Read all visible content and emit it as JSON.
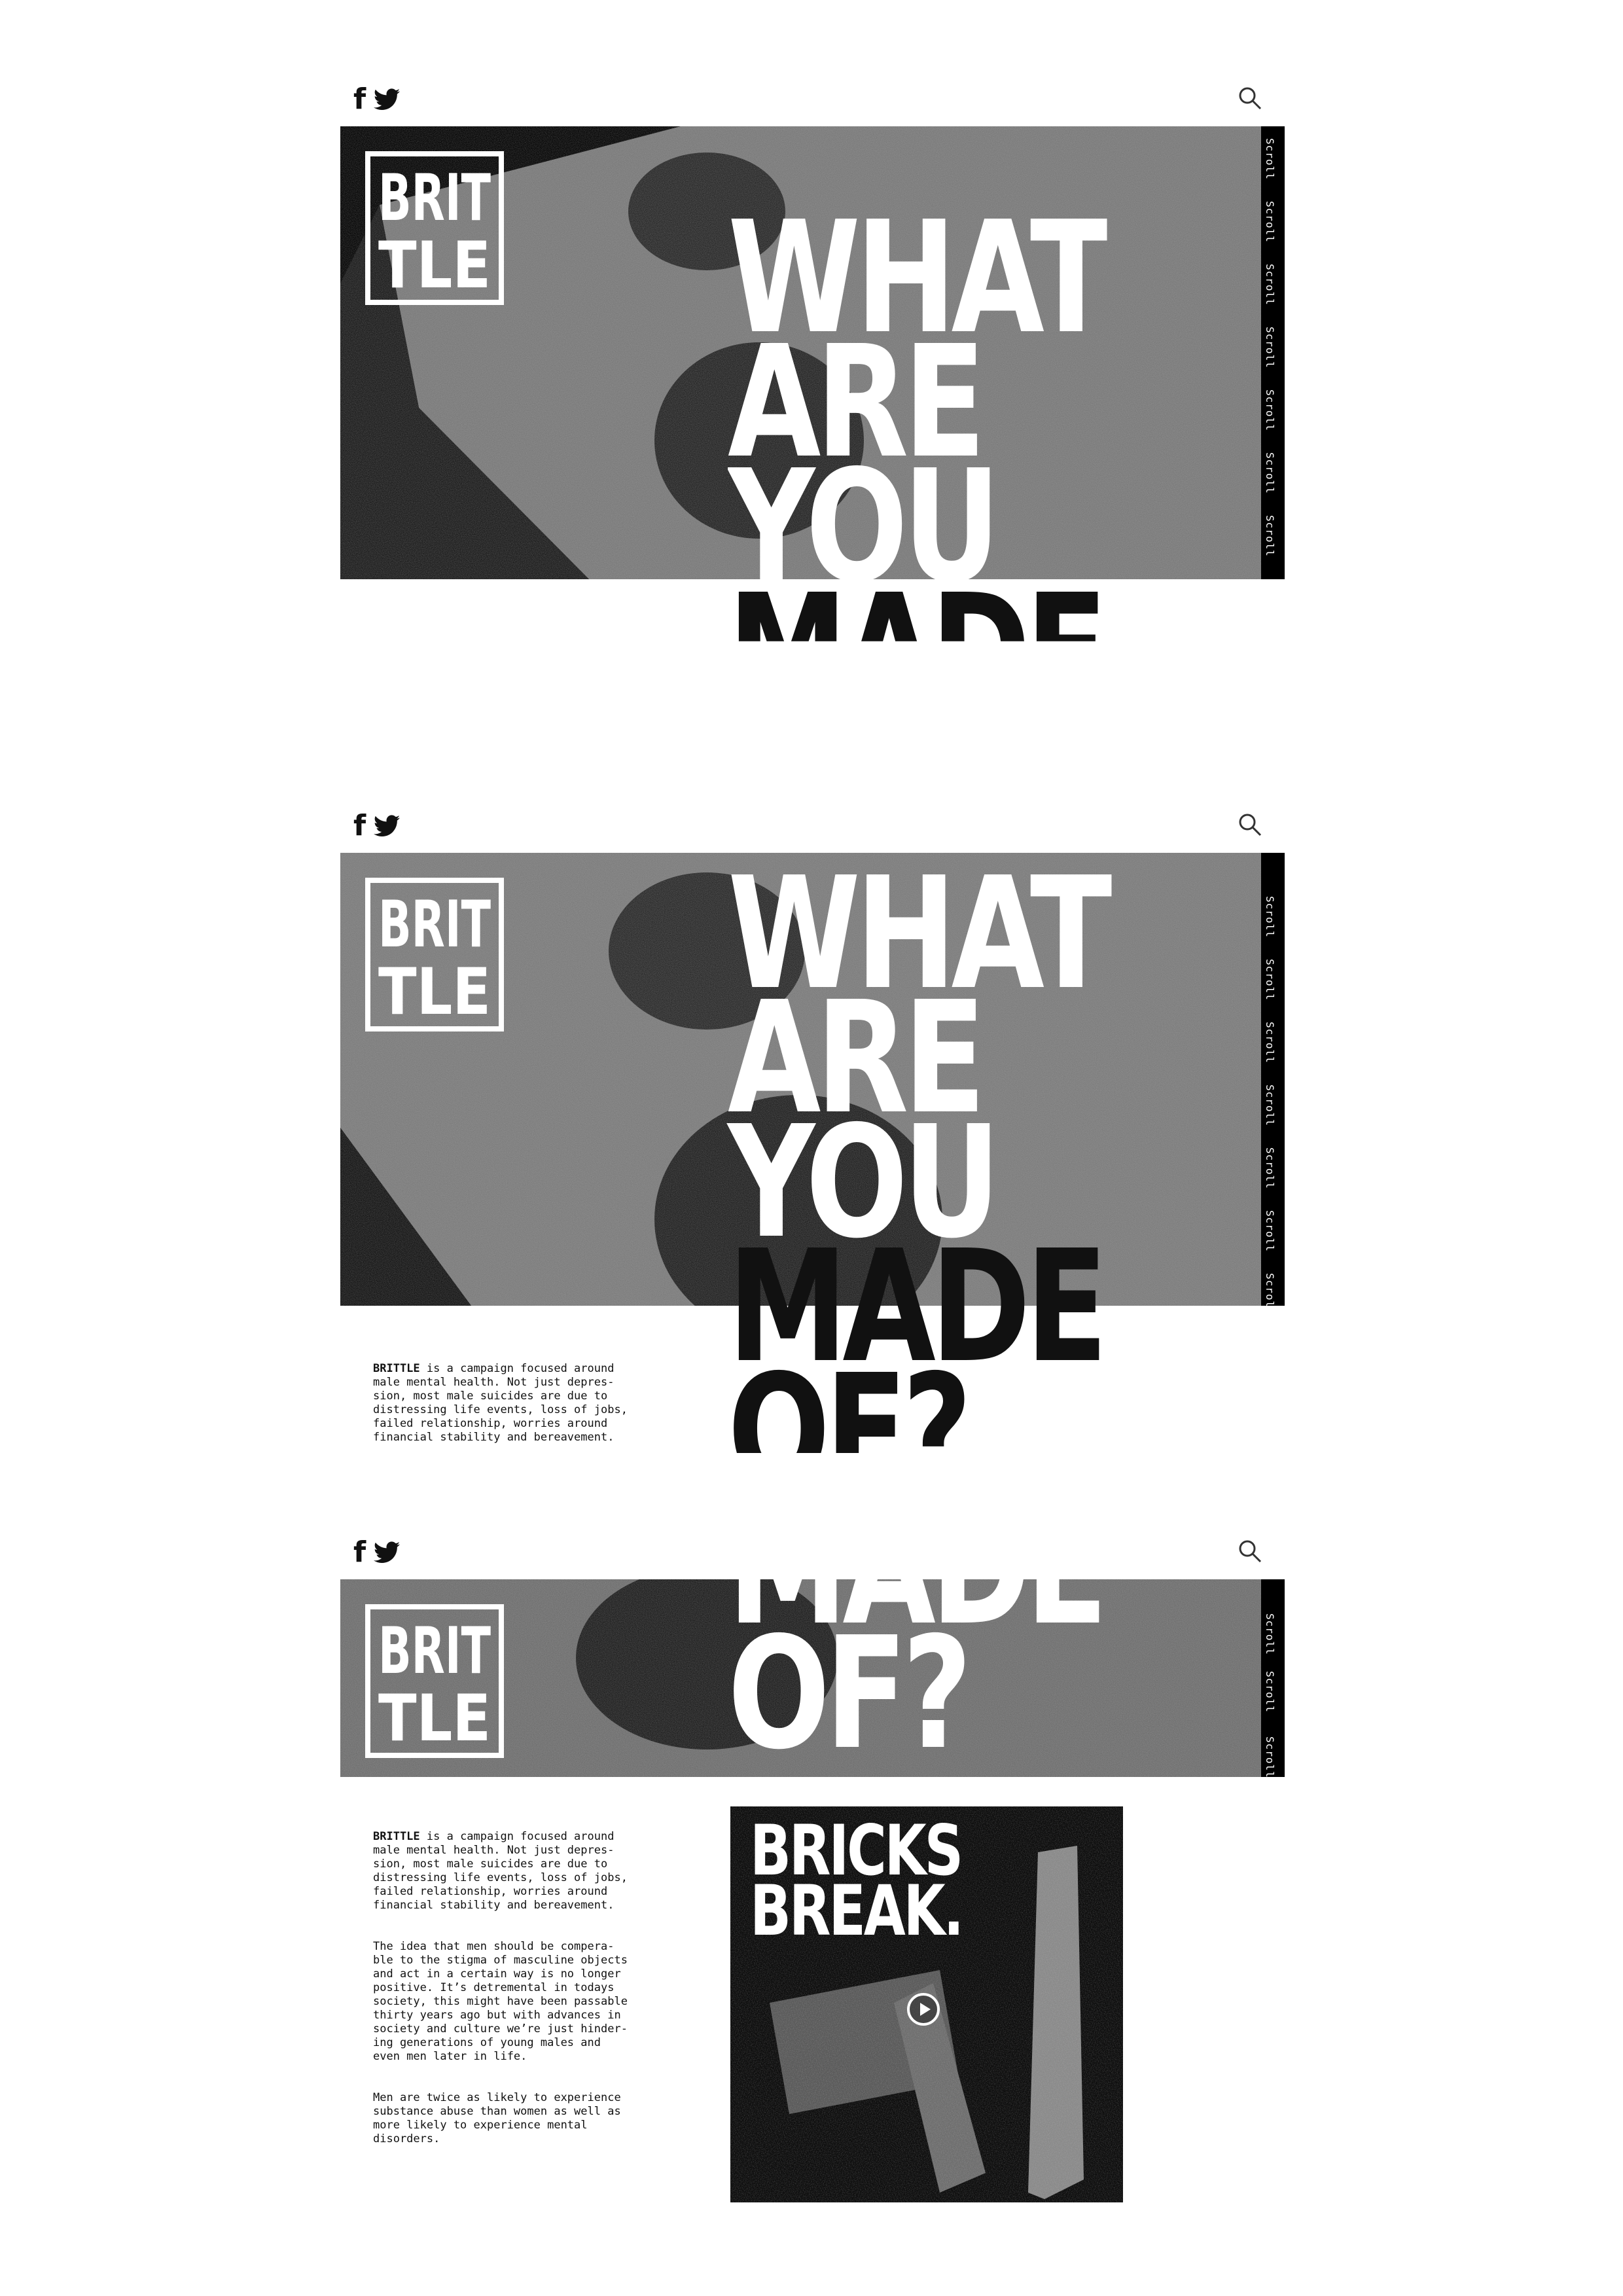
{
  "brand": {
    "logo_line1": "BRIT",
    "logo_line2": "TLE"
  },
  "header": {
    "facebook_icon": "facebook-icon",
    "twitter_icon": "twitter-icon",
    "search_icon": "search-icon"
  },
  "scroll_label": "Scroll",
  "headline": {
    "line1": "WHAT",
    "line2": "ARE",
    "line3": "YOU",
    "line4": "MADE",
    "line5": "OF?"
  },
  "intro": {
    "brand_word": "BRITTLE",
    "p1": " is a campaign focused around\nmale mental health. Not just depres-\nsion, most male suicides are due to\ndistressing life events, loss of jobs,\nfailed relationship, worries around\nfinancial stability and bereavement.",
    "p2": "The idea that men should be compera-\nble to the stigma of masculine objects\nand act in a certain way is no longer\npositive. It’s detremental in todays\nsociety, this might have been passable\nthirty years ago but with advances in\nsociety and culture we’re just hinder-\ning generations of young males and\neven men later in life.",
    "p3": "Men are twice as likely to experience\nsubstance abuse than women as well as\nmore likely to experience mental\ndisorders."
  },
  "video": {
    "title_line1": "BRICKS",
    "title_line2": "BREAK.",
    "play_icon": "play-icon"
  },
  "colors": {
    "ink": "#111111",
    "paper": "#ffffff",
    "faded": "#c4c4c4"
  }
}
